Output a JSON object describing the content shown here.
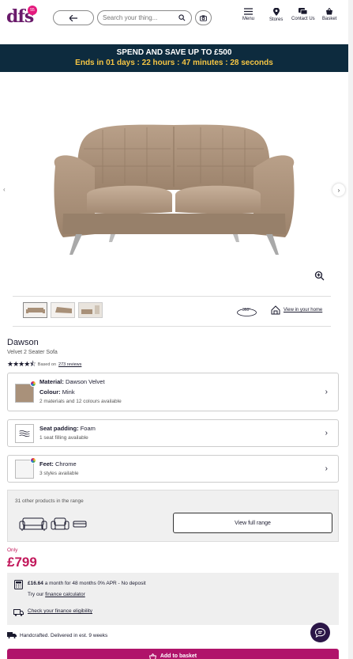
{
  "header": {
    "logo_text": "dfs",
    "logo_badge": "55",
    "search_placeholder": "Search your thing...",
    "nav": [
      {
        "label": "Menu",
        "icon": "hamburger-icon"
      },
      {
        "label": "Stores",
        "icon": "location-pin-icon"
      },
      {
        "label": "Contact Us",
        "icon": "chat-icon"
      },
      {
        "label": "Basket",
        "icon": "basket-icon"
      }
    ]
  },
  "banner": {
    "title": "SPEND AND SAVE UP TO £500",
    "countdown": "Ends in  01 days : 22 hours : 47 minutes : 28 seconds",
    "bg_color": "#0d2b3e",
    "countdown_color": "#f5c544"
  },
  "gallery": {
    "view_360_label": "360°",
    "view_in_home_label": "View in your home",
    "thumbnails": 3
  },
  "product": {
    "name": "Dawson",
    "subtitle": "Velvet 2 Seater Sofa",
    "rating_stars": 4.5,
    "rating_prefix": "Based on",
    "rating_link": "273 reviews"
  },
  "options": {
    "material": {
      "label": "Material:",
      "value": "Dawson Velvet",
      "colour_label": "Colour:",
      "colour_value": "Mink",
      "sub": "2 materials and 12 colours available",
      "swatch_color": "#a9917a"
    },
    "seat": {
      "label": "Seat padding:",
      "value": "Foam",
      "sub": "1 seat filling available"
    },
    "feet": {
      "label": "Feet:",
      "value": "Chrome",
      "sub": "3 styles available"
    }
  },
  "range": {
    "text": "31 other products in the range",
    "button": "View full range"
  },
  "price": {
    "only": "Only",
    "amount": "£799",
    "color": "#c2185b"
  },
  "finance": {
    "monthly": "£16.64",
    "monthly_rest": " a month for 48 months 0% APR - No deposit",
    "try_prefix": "Try our ",
    "calculator_link": "finance calculator",
    "eligibility_link": "Check your finance eligibility"
  },
  "delivery": {
    "text": "Handcrafted. Delivered in est. 9 weeks"
  },
  "basket_button": "Add to basket"
}
